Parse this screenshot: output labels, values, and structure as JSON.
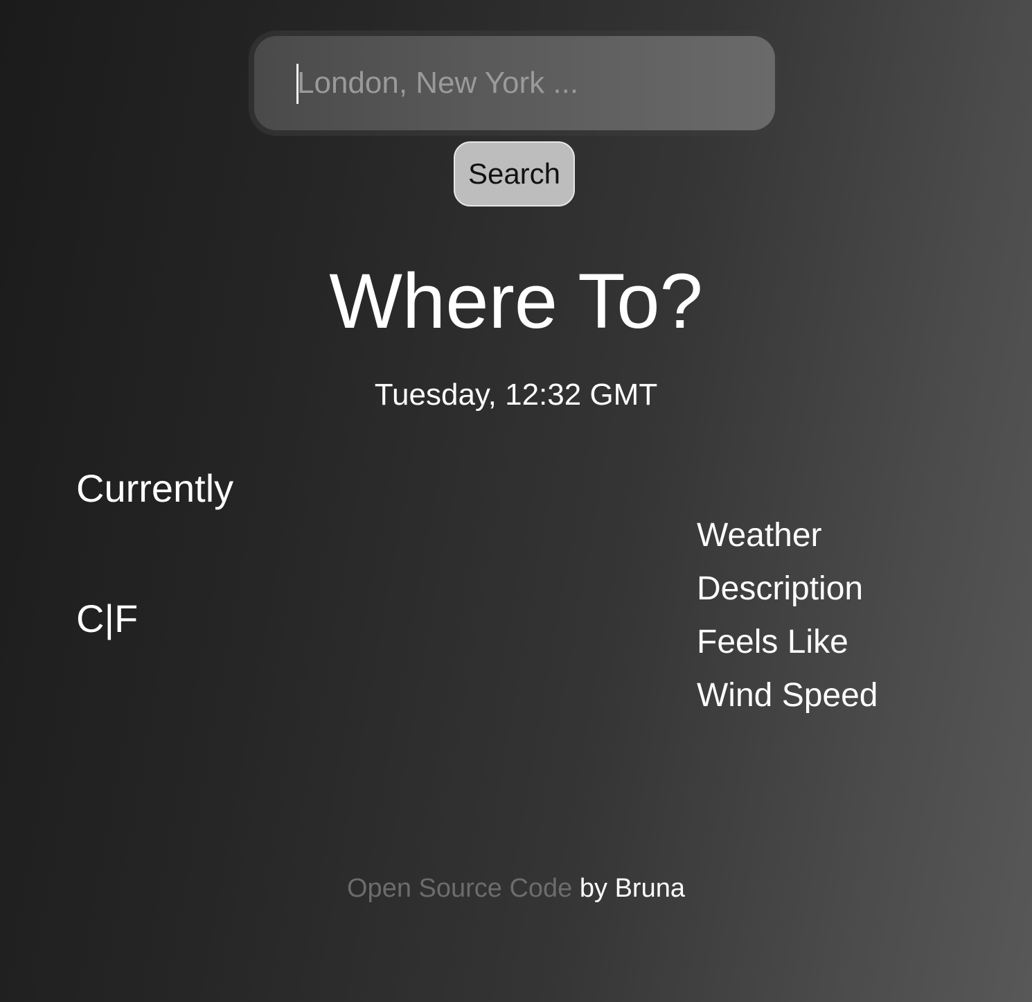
{
  "search": {
    "placeholder": "London, New York ...",
    "value": "",
    "button_label": "Search"
  },
  "header": {
    "title": "Where To?",
    "datetime": "Tuesday, 12:32 GMT"
  },
  "current": {
    "label": "Currently",
    "unit_celsius": "C",
    "unit_separator": "|",
    "unit_fahrenheit": "F"
  },
  "details": {
    "items": [
      {
        "label": "Weather"
      },
      {
        "label": "Description"
      },
      {
        "label": "Feels Like"
      },
      {
        "label": "Wind Speed"
      }
    ]
  },
  "footer": {
    "link_text": "Open Source Code",
    "author_text": "by Bruna"
  },
  "colors": {
    "background_dark": "#1b1b1b",
    "background_light": "#585858",
    "button_bg": "#bdbdbd",
    "footer_link": "#6c6c6c",
    "text": "#ffffff"
  }
}
